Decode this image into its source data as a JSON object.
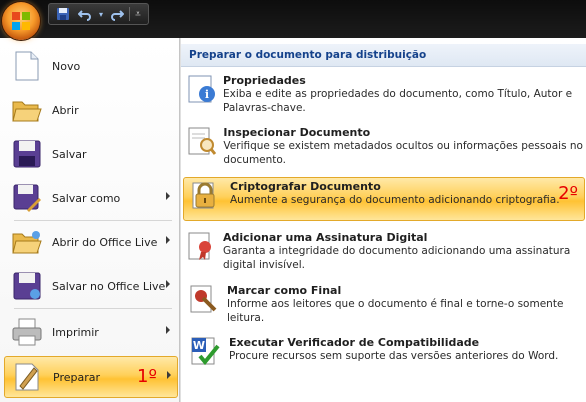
{
  "menu": {
    "items": [
      {
        "label": "Novo",
        "icon": "new-document-icon",
        "arrow": false
      },
      {
        "label": "Abrir",
        "icon": "open-folder-icon",
        "arrow": false
      },
      {
        "label": "Salvar",
        "icon": "save-disk-icon",
        "arrow": false
      },
      {
        "label": "Salvar como",
        "icon": "save-as-icon",
        "arrow": true
      },
      {
        "label": "Abrir do Office Live",
        "icon": "open-office-live-icon",
        "arrow": true
      },
      {
        "label": "Salvar no Office Live",
        "icon": "save-office-live-icon",
        "arrow": true
      },
      {
        "label": "Imprimir",
        "icon": "printer-icon",
        "arrow": true
      },
      {
        "label": "Preparar",
        "icon": "prepare-icon",
        "arrow": true
      }
    ],
    "step_marker": "1º"
  },
  "panel": {
    "header": "Preparar o documento para distribuição",
    "step_marker": "2º",
    "items": [
      {
        "title": "Propriedades",
        "desc": "Exiba e edite as propriedades do documento, como Título, Autor e Palavras-chave.",
        "icon": "properties-icon"
      },
      {
        "title": "Inspecionar Documento",
        "desc": "Verifique se existem metadados ocultos ou informações pessoais no documento.",
        "icon": "inspect-document-icon"
      },
      {
        "title": "Criptografar Documento",
        "desc": "Aumente a segurança do documento adicionando criptografia.",
        "icon": "encrypt-lock-icon"
      },
      {
        "title": "Adicionar uma Assinatura Digital",
        "desc": "Garanta a integridade do documento adicionando uma assinatura digital invisível.",
        "icon": "digital-signature-icon"
      },
      {
        "title": "Marcar como Final",
        "desc": "Informe aos leitores que o documento é final e torne-o somente leitura.",
        "icon": "mark-final-icon"
      },
      {
        "title": "Executar Verificador de Compatibilidade",
        "desc": "Procure recursos sem suporte das versões anteriores do Word.",
        "icon": "compatibility-checker-icon"
      }
    ]
  }
}
